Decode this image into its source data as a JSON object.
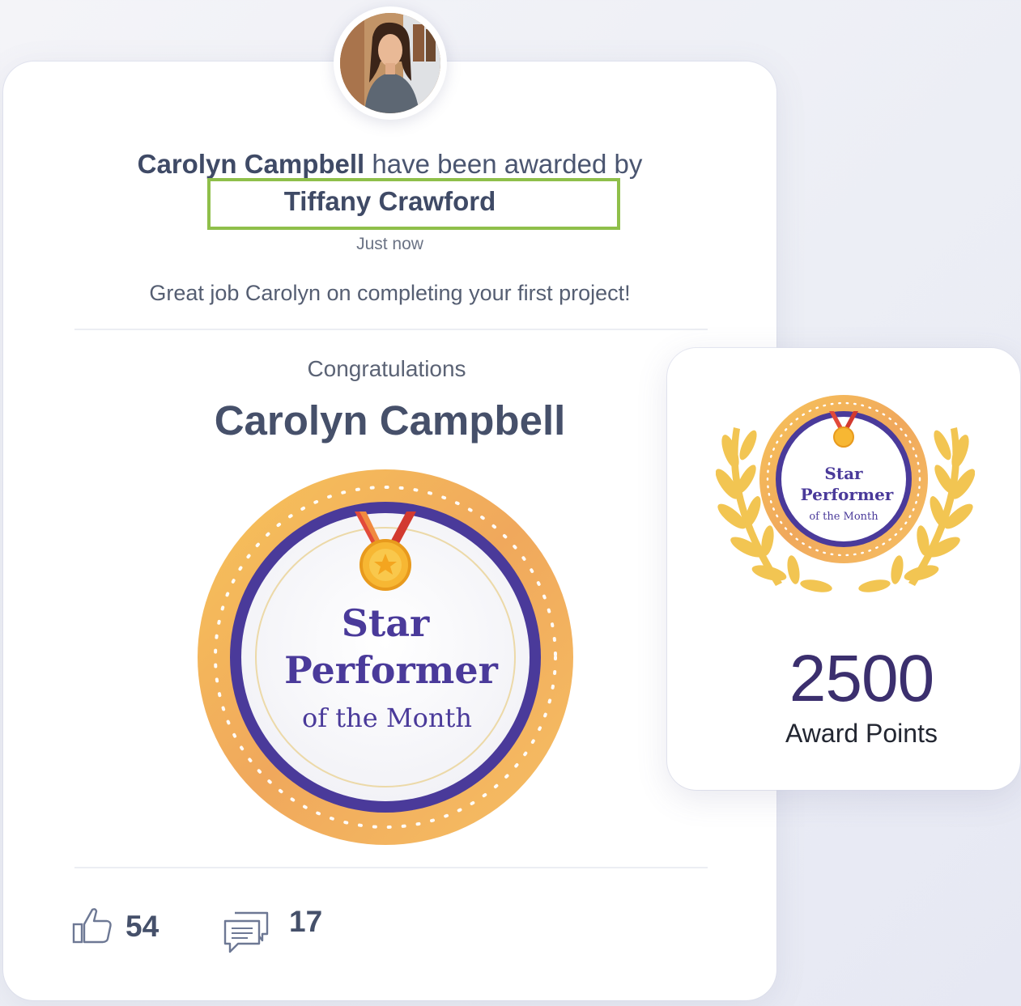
{
  "feed_post": {
    "recipient_name": "Carolyn Campbell",
    "awarded_by_text": "have been awarded by",
    "giver_name": "Tiffany Crawford",
    "timestamp": "Just now",
    "message": "Great job Carolyn on completing your first project!",
    "congrats_label": "Congratulations",
    "badge": {
      "line1": "Star",
      "line2": "Performer",
      "line3": "of the Month"
    },
    "likes_count": "54",
    "comments_count": "17"
  },
  "points_card": {
    "value": "2500",
    "label": "Award Points",
    "badge": {
      "line1": "Star",
      "line2": "Performer",
      "line3": "of the Month"
    }
  },
  "colors": {
    "highlight_border": "#8fbf4a",
    "badge_purple": "#4a3a9a",
    "badge_gold": "#f0b44a",
    "text_dark": "#3f4a66"
  },
  "icons": [
    "avatar-photo",
    "thumbs-up-icon",
    "comment-icon",
    "medal-icon",
    "laurel-wreath-icon"
  ]
}
